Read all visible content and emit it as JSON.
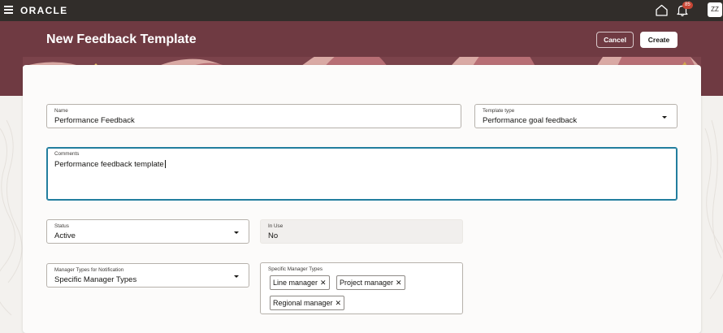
{
  "topbar": {
    "logo": "ORACLE",
    "notification_count": "85",
    "user_initials": "ZZ"
  },
  "header": {
    "title": "New Feedback Template",
    "cancel_label": "Cancel",
    "create_label": "Create"
  },
  "form": {
    "name": {
      "label": "Name",
      "value": "Performance Feedback"
    },
    "template_type": {
      "label": "Template type",
      "value": "Performance goal feedback"
    },
    "comments": {
      "label": "Comments",
      "value": "Performance feedback template"
    },
    "status": {
      "label": "Status",
      "value": "Active"
    },
    "in_use": {
      "label": "In Use",
      "value": "No"
    },
    "manager_types_notification": {
      "label": "Manager Types for Notification",
      "value": "Specific Manager Types"
    },
    "specific_manager_types": {
      "label": "Specific Manager Types",
      "chips": [
        "Line manager",
        "Project manager",
        "Regional manager"
      ]
    }
  },
  "colors": {
    "topbar": "#312d2a",
    "banner": "#6f3a42",
    "focus": "#227e9e",
    "badge": "#c74634"
  }
}
